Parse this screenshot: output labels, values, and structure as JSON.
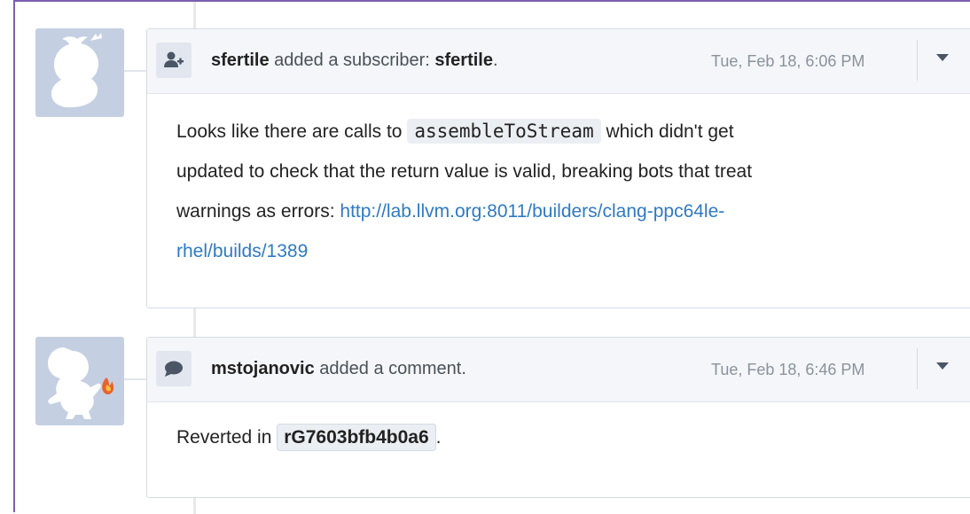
{
  "events": [
    {
      "avatar_icon": "psyduck-silhouette-avatar",
      "type_icon": "add-user-icon",
      "header": {
        "author": "sfertile",
        "action": "added a subscriber:",
        "target": "sfertile",
        "punct": "."
      },
      "timestamp": "Tue, Feb 18, 6:06 PM",
      "body": {
        "line1_pre": "Looks like there are calls to",
        "code": "assembleToStream",
        "line1_post": "which didn't get",
        "line2": "updated to check that the return value is valid, breaking bots that treat",
        "line3_pre": "warnings as errors:",
        "link_part1": "http://lab.llvm.org:8011/builders/clang-ppc64le-",
        "link_part2": "rhel/builds/1389"
      }
    },
    {
      "avatar_icon": "charmander-silhouette-avatar",
      "type_icon": "comment-icon",
      "header": {
        "author": "mstojanovic",
        "action": "added a comment."
      },
      "timestamp": "Tue, Feb 18, 6:46 PM",
      "body": {
        "pre": "Reverted in",
        "commit": "rG7603bfb4b0a6",
        "post": "."
      }
    }
  ],
  "colors": {
    "frame": "#7b5fb0",
    "avatar_bg": "#c4cfe2",
    "link": "#2f7ac2",
    "header_bg": "#f4f6f9"
  }
}
